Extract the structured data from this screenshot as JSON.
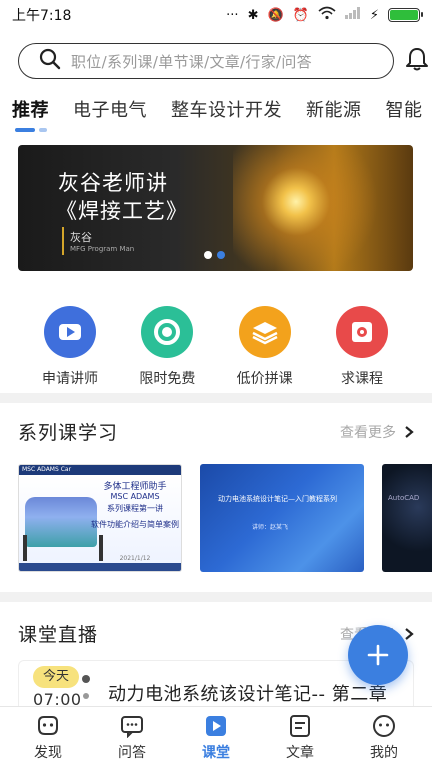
{
  "status_bar": {
    "time": "上午7:18"
  },
  "search": {
    "placeholder": "职位/系列课/单节课/文章/行家/问答"
  },
  "tabs": [
    {
      "label": "推荐"
    },
    {
      "label": "电子电气"
    },
    {
      "label": "整车设计开发"
    },
    {
      "label": "新能源"
    },
    {
      "label": "智能"
    }
  ],
  "banner": {
    "title_line1": "灰谷老师讲",
    "title_line2": "《焊接工艺》",
    "name": "灰谷",
    "role": "MFG Program Man",
    "slide_count": 2,
    "active_slide": 2
  },
  "quick_actions": [
    {
      "label": "申请讲师",
      "icon": "play-video-icon",
      "color": "#3f6fdc"
    },
    {
      "label": "限时免费",
      "icon": "timer-ring-icon",
      "color": "#2bbf97"
    },
    {
      "label": "低价拼课",
      "icon": "stack-layers-icon",
      "color": "#f3a21c"
    },
    {
      "label": "求课程",
      "icon": "request-square-icon",
      "color": "#e84a4a"
    }
  ],
  "series_section": {
    "title": "系列课学习",
    "more_label": "查看更多",
    "cards": [
      {
        "header": "MSC ADAMS Car",
        "line1": "多体工程师助手",
        "line2": "MSC ADAMS",
        "line3": "系列课程第一讲",
        "line4": "软件功能介绍与简单案例",
        "footer": "2021/1/12"
      },
      {
        "line1": "动力电池系统设计笔记—入门教程系列",
        "line2": "讲师：赵某飞"
      },
      {
        "line1": "AutoCAD"
      }
    ]
  },
  "live_section": {
    "title": "课堂直播",
    "more_label": "查看更多",
    "item": {
      "badge": "今天",
      "time": "07:00",
      "title": "动力电池系统该设计笔记-- 第二章"
    }
  },
  "bottom_nav": [
    {
      "label": "发现",
      "icon": "discover-icon"
    },
    {
      "label": "问答",
      "icon": "qa-chat-icon"
    },
    {
      "label": "课堂",
      "icon": "classroom-play-icon",
      "active": true
    },
    {
      "label": "文章",
      "icon": "article-icon"
    },
    {
      "label": "我的",
      "icon": "profile-face-icon"
    }
  ],
  "colors": {
    "accent": "#3b7fe0",
    "tab_indicator": "#3b7fe0",
    "tab_indicator_light": "#a9c6f0",
    "badge": "#f7e27d"
  }
}
